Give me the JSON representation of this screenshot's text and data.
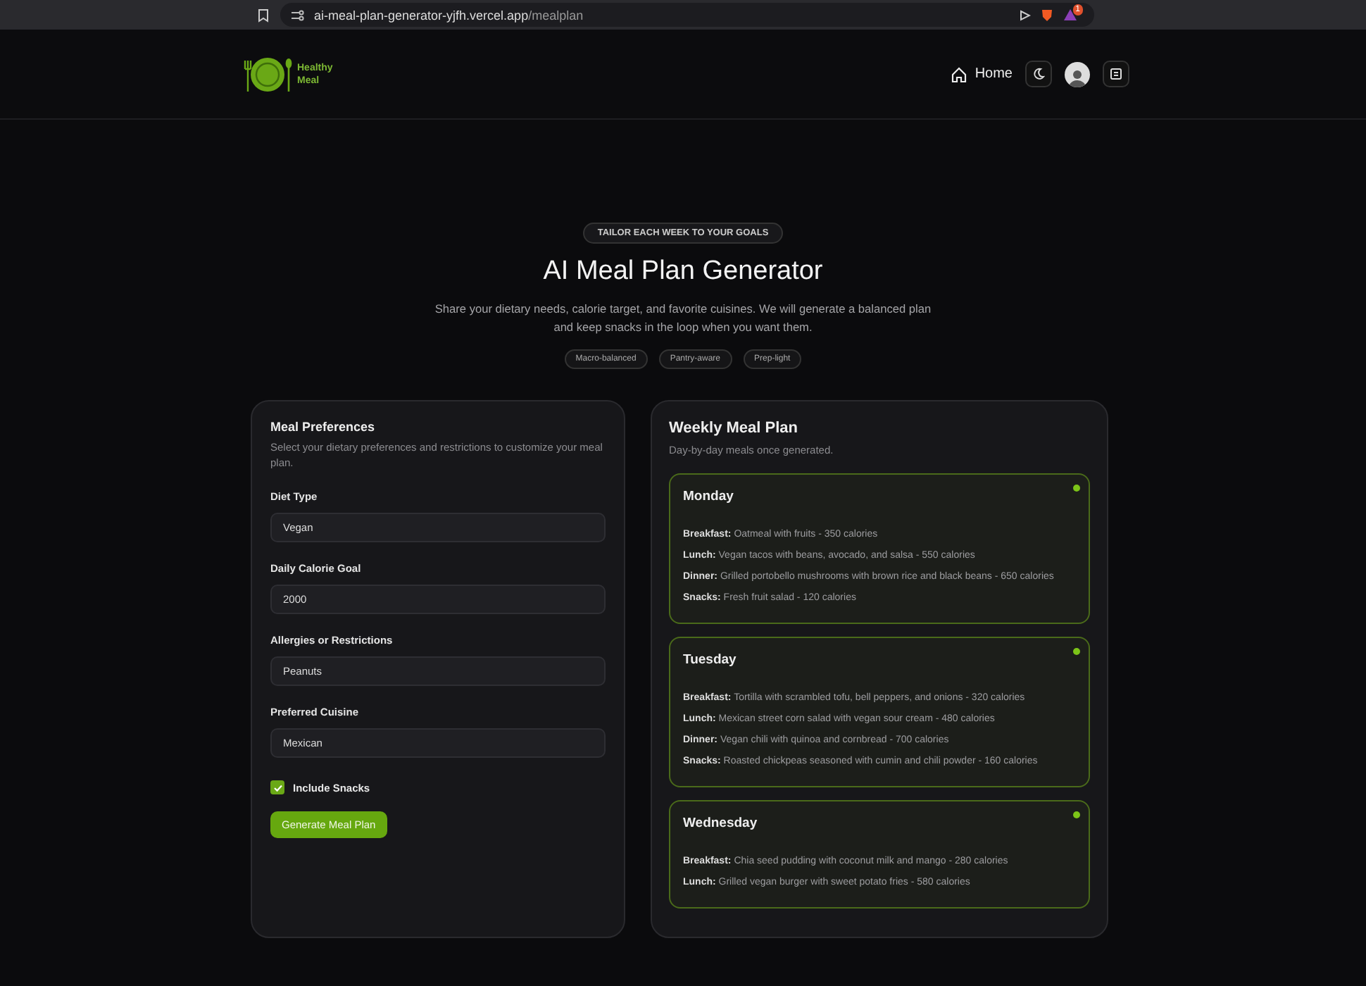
{
  "browser": {
    "url_host": "ai-meal-plan-generator-yjfh.vercel.app",
    "url_path": "/mealplan",
    "notification_count": "1"
  },
  "header": {
    "logo_text": "Healthy Meal",
    "nav": [
      {
        "label": "Home"
      }
    ]
  },
  "hero": {
    "badge": "TAILOR EACH WEEK TO YOUR GOALS",
    "title": "AI Meal Plan Generator",
    "subtitle": "Share your dietary needs, calorie target, and favorite cuisines. We will generate a balanced plan and keep snacks in the loop when you want them.",
    "tags": [
      "Macro-balanced",
      "Pantry-aware",
      "Prep-light"
    ]
  },
  "preferences": {
    "title": "Meal Preferences",
    "description": "Select your dietary preferences and restrictions to customize your meal plan.",
    "fields": [
      {
        "label": "Diet Type",
        "value": "Vegan"
      },
      {
        "label": "Daily Calorie Goal",
        "value": "2000"
      },
      {
        "label": "Allergies or Restrictions",
        "value": "Peanuts"
      },
      {
        "label": "Preferred Cuisine",
        "value": "Mexican"
      }
    ],
    "include_snacks": {
      "label": "Include Snacks",
      "checked": true
    },
    "submit": "Generate Meal Plan"
  },
  "plan": {
    "title": "Weekly Meal Plan",
    "subtitle": "Day-by-day meals once generated.",
    "days": [
      {
        "day": "Monday",
        "color": "#7cc418",
        "meals": [
          "**Breakfast:** Oatmeal with fruits - 350 calories",
          "**Lunch:** Vegan tacos with beans, avocado, and salsa - 550 calories",
          "**Dinner:** Grilled portobello mushrooms with brown rice and black beans - 650 calories",
          "**Snacks:** Fresh fruit salad - 120 calories"
        ]
      },
      {
        "day": "Tuesday",
        "color": "#7cc418",
        "meals": [
          "**Breakfast:** Tortilla with scrambled tofu, bell peppers, and onions - 320 calories",
          "**Lunch:** Mexican street corn salad with vegan sour cream - 480 calories",
          "**Dinner:** Vegan chili with quinoa and cornbread - 700 calories",
          "**Snacks:** Roasted chickpeas seasoned with cumin and chili powder - 160 calories"
        ]
      },
      {
        "day": "Wednesday",
        "color": "#7cc418",
        "meals": [
          "**Breakfast:** Chia seed pudding with coconut milk and mango - 280 calories",
          "**Lunch:** Grilled vegan burger with sweet potato fries - 580 calories"
        ]
      }
    ]
  }
}
